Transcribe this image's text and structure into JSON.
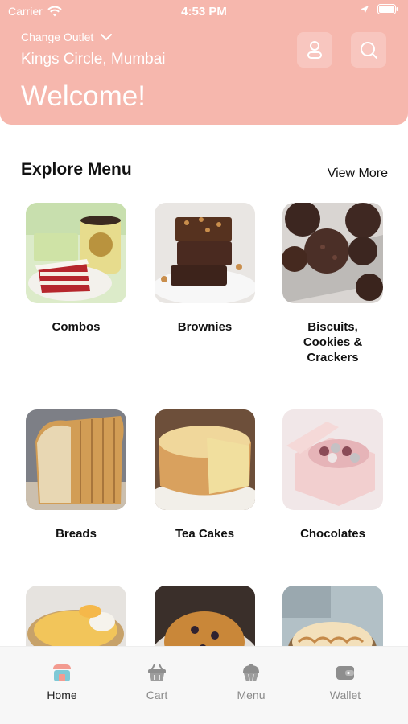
{
  "status_bar": {
    "carrier": "Carrier",
    "time": "4:53 PM"
  },
  "header": {
    "change_outlet_label": "Change Outlet",
    "outlet_name": "Kings Circle, Mumbai",
    "welcome": "Welcome!",
    "background_color": "#f6b7ad"
  },
  "explore": {
    "title": "Explore Menu",
    "view_more": "View More",
    "items": [
      {
        "label": "Combos"
      },
      {
        "label": "Brownies"
      },
      {
        "label": "Biscuits, Cookies & Crackers"
      },
      {
        "label": "Breads"
      },
      {
        "label": "Tea Cakes"
      },
      {
        "label": "Chocolates"
      },
      {
        "label": ""
      },
      {
        "label": ""
      },
      {
        "label": ""
      }
    ]
  },
  "tabbar": {
    "tabs": [
      {
        "label": "Home",
        "icon": "shop-icon",
        "active": true
      },
      {
        "label": "Cart",
        "icon": "basket-icon",
        "active": false
      },
      {
        "label": "Menu",
        "icon": "cupcake-icon",
        "active": false
      },
      {
        "label": "Wallet",
        "icon": "wallet-icon",
        "active": false
      }
    ]
  }
}
